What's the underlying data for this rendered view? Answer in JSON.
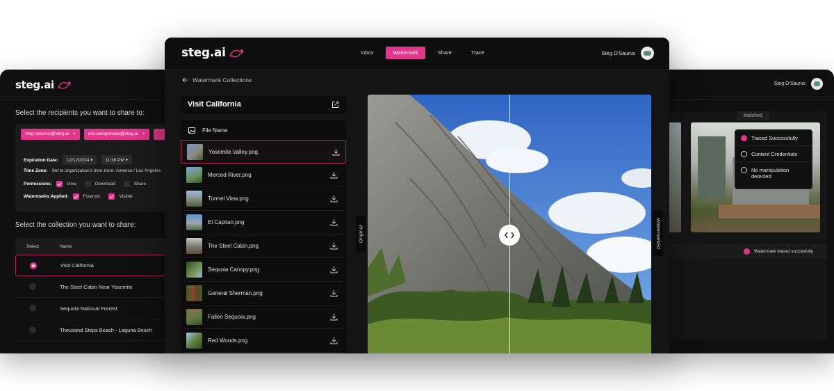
{
  "colors": {
    "accent": "#e0378c",
    "background": "#141414",
    "panel": "#0c0c0c"
  },
  "left_window": {
    "logo": "steg.ai",
    "recipients_title": "Select the recipients you want to share to:",
    "recipients": [
      "steg.osaurus@steg.ai",
      "eric.wengrowski@steg.ai"
    ],
    "chip_close": "×",
    "expiration_label": "Expiration Date:",
    "expiration_date": "12/12/2024",
    "expiration_time": "11:36 PM",
    "timezone_label": "Time Zone:",
    "timezone_value": "Set to organization's time zone: America / Los Angeles",
    "permissions_label": "Permissions:",
    "permissions": [
      {
        "label": "View",
        "checked": true
      },
      {
        "label": "Download",
        "checked": false
      },
      {
        "label": "Share",
        "checked": false
      }
    ],
    "watermarks_label": "Watermarks Applied:",
    "watermarks": [
      {
        "label": "Forensic",
        "checked": true
      },
      {
        "label": "Visible",
        "checked": true
      }
    ],
    "collection_title": "Select the collection you want to share:",
    "table_headers": {
      "select": "Select",
      "name": "Name"
    },
    "collections": [
      {
        "name": "Visit California",
        "selected": true
      },
      {
        "name": "The Steel Cabin Near Yosemite",
        "selected": false
      },
      {
        "name": "Sequoia National Forrest",
        "selected": false
      },
      {
        "name": "Thousand Steps Beach - Laguna Beach",
        "selected": false
      }
    ]
  },
  "right_window": {
    "user_name": "Steg O'Saurus",
    "matched_label": "Matched",
    "trace_results": [
      {
        "label": "Traced Successfully",
        "icon": "check-circle-icon"
      },
      {
        "label": "Content Credentials",
        "icon": "credentials-icon"
      },
      {
        "label": "No manipulation detected",
        "icon": "no-manipulation-icon"
      }
    ],
    "status_text": "Watermark traced succesfully"
  },
  "main": {
    "logo": "steg.ai",
    "nav_tabs": [
      {
        "label": "Inbox",
        "active": false
      },
      {
        "label": "Watermark",
        "active": true
      },
      {
        "label": "Share",
        "active": false
      },
      {
        "label": "Trace",
        "active": false
      }
    ],
    "user_name": "Steg O'Saurus",
    "breadcrumb": "Watermark Collections",
    "collection_title": "Visit California",
    "file_column_header": "File Name",
    "files": [
      {
        "name": "Yosemite Valley.png",
        "selected": true
      },
      {
        "name": "Merced River.png",
        "selected": false
      },
      {
        "name": "Tunnel View.png",
        "selected": false
      },
      {
        "name": "El Capitan.png",
        "selected": false
      },
      {
        "name": "The Steel Cabin.png",
        "selected": false
      },
      {
        "name": "Sequoia Canopy.png",
        "selected": false
      },
      {
        "name": "General Sherman.png",
        "selected": false
      },
      {
        "name": "Fallen Sequoia.png",
        "selected": false
      },
      {
        "name": "Red Woods.png",
        "selected": false
      }
    ],
    "viewer_left_label": "Original",
    "viewer_right_label": "Watermarked"
  }
}
